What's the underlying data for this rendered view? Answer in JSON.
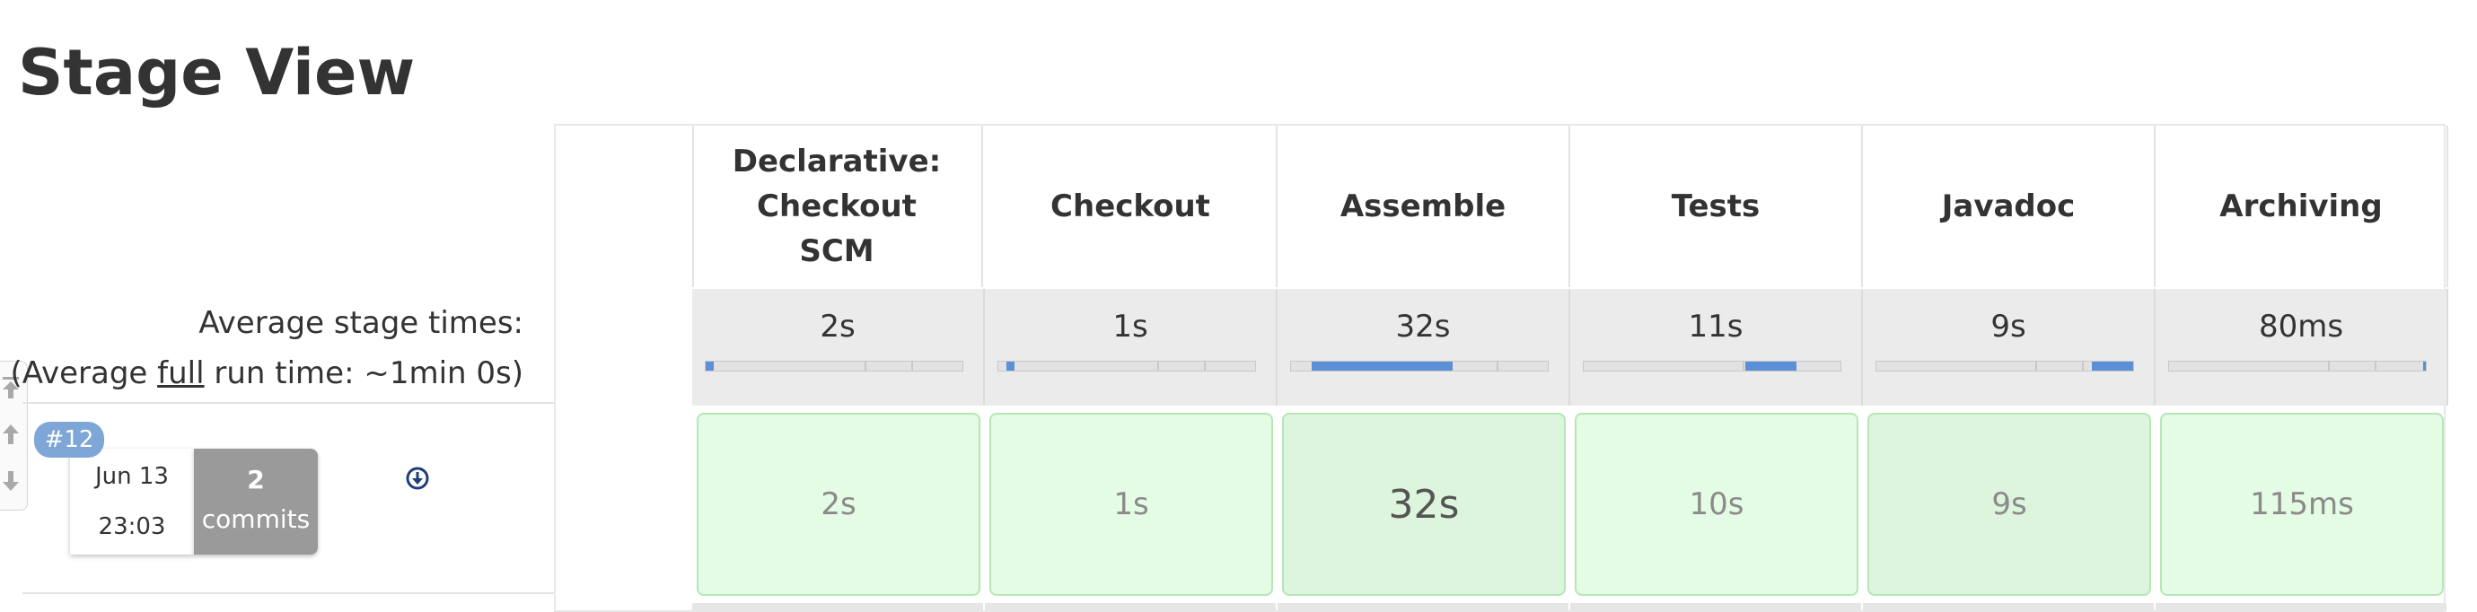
{
  "page_title": "Stage View",
  "averages": {
    "label_line1": "Average stage times:",
    "label_prefix": "(Average ",
    "label_underlined": "full",
    "label_suffix": " run time: ~1min 0s)"
  },
  "stages": [
    {
      "name": "Declarative: Checkout SCM",
      "avg": "2s",
      "run": "2s",
      "bar_fill_fraction": 0.03
    },
    {
      "name": "Checkout",
      "avg": "1s",
      "run": "1s",
      "bar_fill_fraction": 0.03
    },
    {
      "name": "Assemble",
      "avg": "32s",
      "run": "32s",
      "bar_fill_fraction": 0.55
    },
    {
      "name": "Tests",
      "avg": "11s",
      "run": "10s",
      "bar_fill_fraction": 0.2
    },
    {
      "name": "Javadoc",
      "avg": "9s",
      "run": "9s",
      "bar_fill_fraction": 0.16
    },
    {
      "name": "Archiving",
      "avg": "80ms",
      "run": "115ms",
      "bar_fill_fraction": 0.01
    }
  ],
  "build": {
    "number": "#12",
    "date": "Jun 13",
    "time": "23:03",
    "commits_count": "2",
    "commits_word": "commits"
  },
  "icons": {
    "download": "download-icon",
    "scroll_top": "arrow-top-icon",
    "scroll_up": "arrow-up-icon",
    "scroll_down": "arrow-down-icon"
  },
  "colors": {
    "success_cell": "#e4fbe4",
    "success_border": "#b8e5b8",
    "build_badge": "#7ea6d6",
    "commits_box": "#9a9a9a",
    "progress_fill": "#5b8fd6"
  }
}
